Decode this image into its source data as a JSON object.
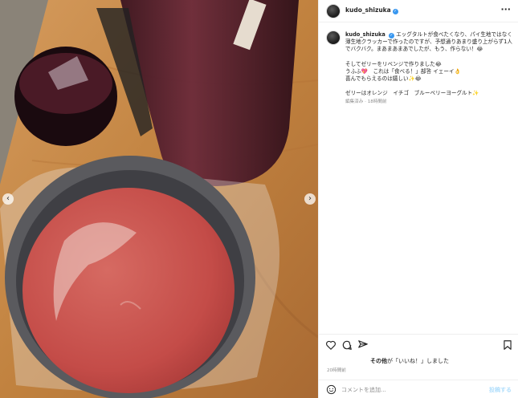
{
  "post": {
    "username": "kudo_shizuka",
    "verified_icon": "verified-badge-icon",
    "more_icon": "more-horizontal-icon"
  },
  "caption": {
    "username": "kudo_shizuka",
    "line1": "エッグタルトが食べたくなり、パイ生地ではなく薄生地クラッカーで作ったのですが、予想通りあまり盛り上がらず1人でバクバク。まあまあまあでしたが、もう、作らない！😂",
    "line2": "そしてゼリーをリベンジで作りました😂",
    "line3": "うふふ💖　これは「食べる！」部答 イェーイ👌",
    "line4": "喜んでもらえるのは嬉しい✨😂",
    "line5": "ゼリーはオレンジ　イチゴ　ブルーベリーヨーグルト✨",
    "meta": "編集済み · 18時間前"
  },
  "actions": {
    "like_icon": "heart-icon",
    "comment_icon": "comment-icon",
    "share_icon": "share-icon",
    "save_icon": "bookmark-icon",
    "likes_prefix": "その他",
    "likes_text": "が「いいね！」しました",
    "time": "20時間前"
  },
  "comment": {
    "emoji_icon": "emoji-icon",
    "placeholder": "コメントを追加...",
    "post_label": "投稿する"
  },
  "carousel": {
    "prev_icon": "chevron-left-icon",
    "next_icon": "chevron-right-icon",
    "prev_glyph": "‹",
    "next_glyph": "›"
  },
  "colors": {
    "jelly": "#c9524e",
    "wood": "#c58a4f",
    "blender_juice": "#5a1e2e",
    "verified": "#3897f0",
    "post_button": "#b2dffc"
  }
}
